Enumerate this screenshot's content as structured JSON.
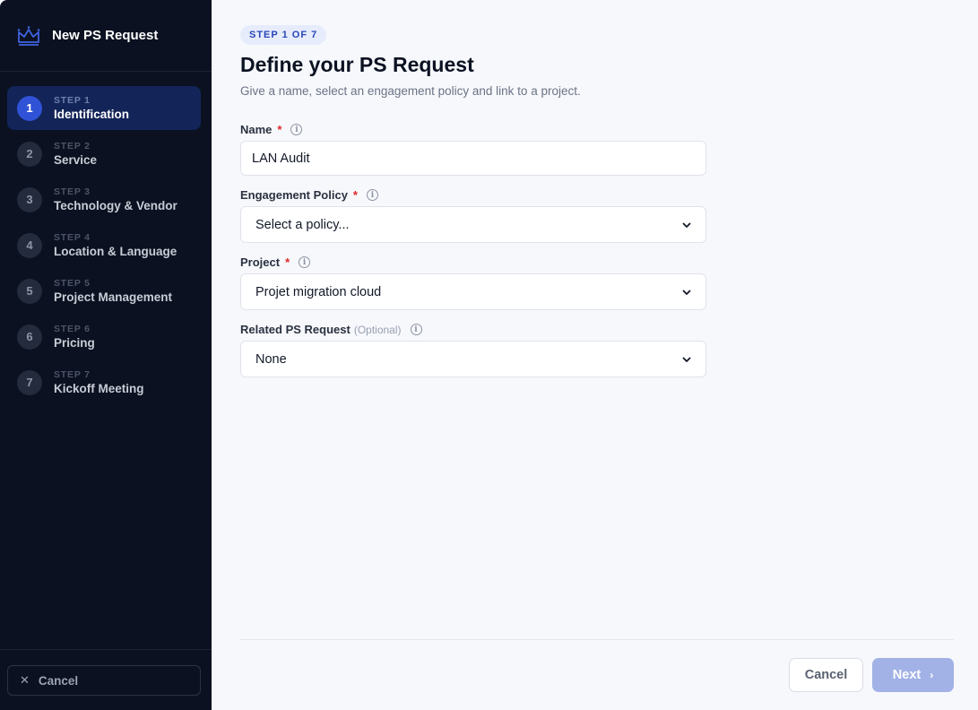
{
  "sidebar": {
    "title": "New PS Request",
    "logo_icon": "crown-icon",
    "steps": [
      {
        "num": "1",
        "kicker": "STEP 1",
        "name": "Identification",
        "active": true
      },
      {
        "num": "2",
        "kicker": "STEP 2",
        "name": "Service",
        "active": false
      },
      {
        "num": "3",
        "kicker": "STEP 3",
        "name": "Technology & Vendor",
        "active": false
      },
      {
        "num": "4",
        "kicker": "STEP 4",
        "name": "Location & Language",
        "active": false
      },
      {
        "num": "5",
        "kicker": "STEP 5",
        "name": "Project Management",
        "active": false
      },
      {
        "num": "6",
        "kicker": "STEP 6",
        "name": "Pricing",
        "active": false
      },
      {
        "num": "7",
        "kicker": "STEP 7",
        "name": "Kickoff Meeting",
        "active": false
      }
    ],
    "cancel_icon": "close-icon",
    "cancel_label": "Cancel"
  },
  "main": {
    "badge": "STEP 1 OF 7",
    "title": "Define your PS Request",
    "subtitle": "Give a name, select an engagement policy and link to a project.",
    "fields": {
      "name": {
        "label": "Name",
        "required": "*",
        "value": "LAN Audit"
      },
      "policy": {
        "label": "Engagement Policy",
        "required": "*",
        "value": "Select a policy..."
      },
      "project": {
        "label": "Project",
        "required": "*",
        "value": "Projet migration cloud"
      },
      "related": {
        "label": "Related PS Request",
        "optional": "(Optional)",
        "value": "None"
      }
    },
    "info_glyph": "i"
  },
  "footer": {
    "cancel_label": "Cancel",
    "next_label": "Next",
    "next_arrow": "›"
  },
  "colors": {
    "sidebar_bg": "#0b1120",
    "active_step_bg": "#132458",
    "accent": "#2f52d6",
    "required": "#dc2626",
    "next_disabled": "#a2b2e6"
  }
}
